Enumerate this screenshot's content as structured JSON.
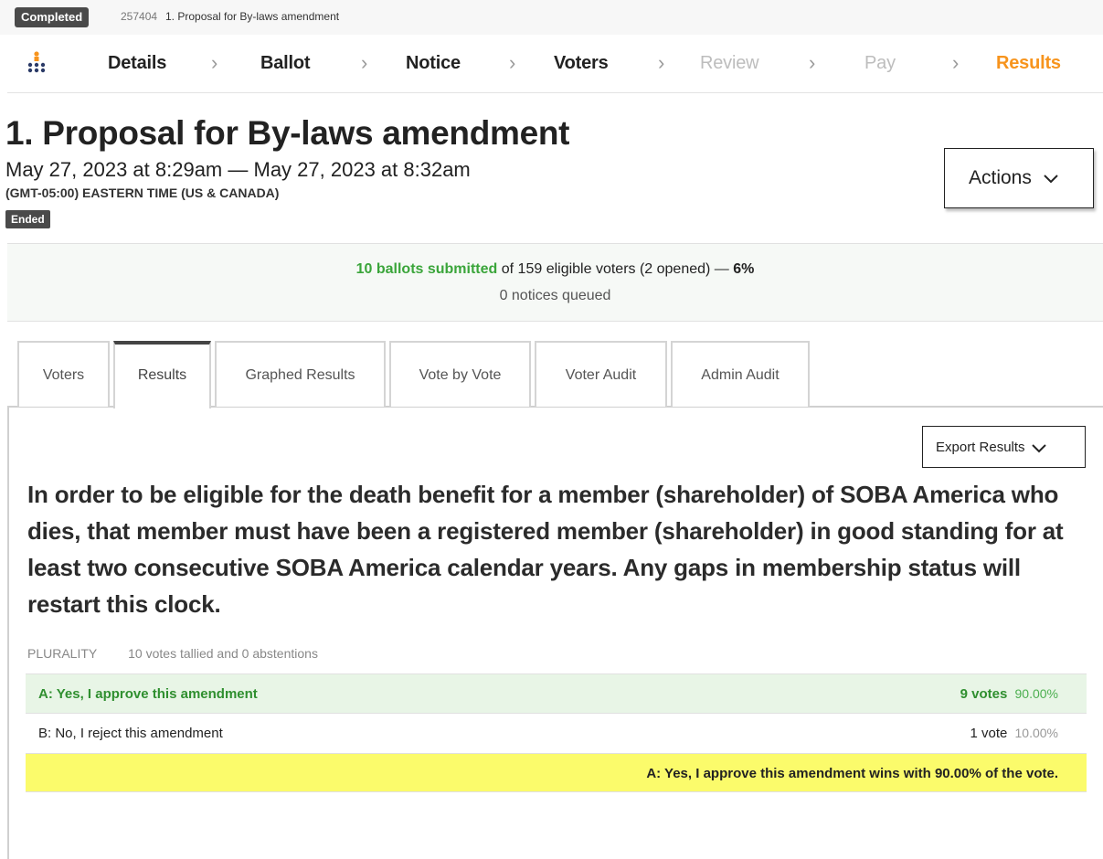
{
  "topbar": {
    "status": "Completed",
    "election_id": "257404",
    "election_name": "1. Proposal for By-laws amendment"
  },
  "steps": [
    "Details",
    "Ballot",
    "Notice",
    "Voters",
    "Review",
    "Pay",
    "Results"
  ],
  "header": {
    "title": "1. Proposal for By-laws amendment",
    "date_range": "May 27, 2023 at 8:29am — May 27, 2023 at 8:32am",
    "timezone": "(GMT-05:00) EASTERN TIME (US & CANADA)",
    "state": "Ended",
    "actions_label": "Actions"
  },
  "stats": {
    "submitted": "10 ballots submitted",
    "eligible": " of 159 eligible voters (2 opened) — ",
    "percent": "6%",
    "notices": "0 notices queued"
  },
  "tabs": [
    "Voters",
    "Results",
    "Graphed Results",
    "Vote by Vote",
    "Voter Audit",
    "Admin Audit"
  ],
  "results": {
    "export_label": "Export Results",
    "question": "In order to be eligible for the death benefit for a member (shareholder) of SOBA America who dies, that member must have been a registered member (shareholder) in good standing for at least two consecutive SOBA America calendar years. Any gaps in membership status will restart this clock.",
    "method": "PLURALITY",
    "tally": "10 votes tallied and 0 abstentions",
    "options": [
      {
        "label": "A: Yes, I approve this amendment",
        "votes": "9 votes",
        "percent": "90.00%"
      },
      {
        "label": "B: No, I reject this amendment",
        "votes": "1 vote",
        "percent": "10.00%"
      }
    ],
    "summary": "A: Yes, I approve this amendment wins with 90.00% of the vote."
  },
  "colors": {
    "accent_orange": "#f7941d",
    "green": "#3aa53a",
    "winner_bg": "#e8f5e6",
    "summary_bg": "#fbfb6b"
  }
}
